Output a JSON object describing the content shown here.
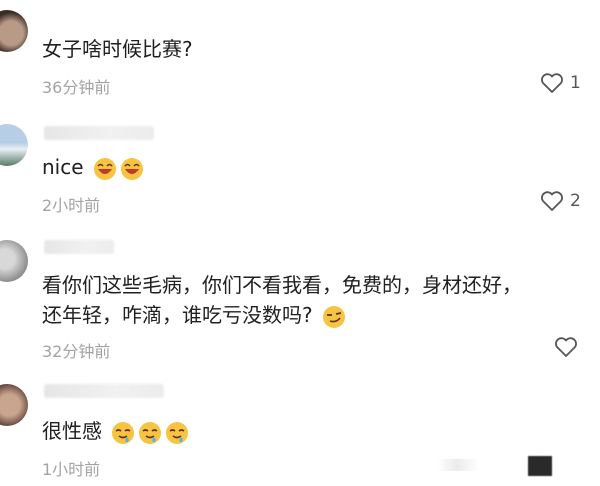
{
  "comments": [
    {
      "text": "女子啥时候比赛?",
      "time": "36分钟前",
      "likes": "1",
      "emoji": []
    },
    {
      "text": "nice",
      "time": "2小时前",
      "likes": "2",
      "emoji": [
        "laugh-emoji",
        "laugh-emoji"
      ]
    },
    {
      "line1": "看你们这些毛病，你们不看我看，免费的，身材还好，",
      "line2": "还年轻，咋滴，谁吃亏没数吗?",
      "time": "32分钟前",
      "likes": "",
      "emoji": [
        "smirk-emoji"
      ]
    },
    {
      "text": "很性感",
      "time": "1小时前",
      "likes": "",
      "emoji": [
        "drool-emoji",
        "drool-emoji",
        "drool-emoji"
      ]
    }
  ],
  "colors": {
    "time": "#a3a3a3",
    "text": "#202020",
    "emoji_yellow": "#f6c343",
    "emoji_dark": "#5a3510"
  }
}
